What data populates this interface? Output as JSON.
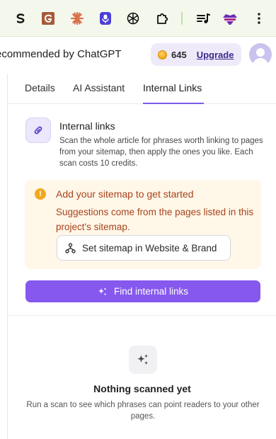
{
  "browser": {
    "extensions": [
      {
        "icon": "s-extension-icon"
      },
      {
        "icon": "g-extension-icon"
      },
      {
        "icon": "claude-icon"
      },
      {
        "icon": "podcast-icon"
      },
      {
        "icon": "chatgpt-icon"
      },
      {
        "icon": "puzzle-icon"
      },
      {
        "icon": "playlist-icon"
      },
      {
        "icon": "incognito-icon"
      },
      {
        "icon": "more-vert-icon"
      }
    ]
  },
  "header": {
    "title": "ecommended by ChatGPT",
    "credits": "645",
    "upgrade_label": "Upgrade"
  },
  "tabs": [
    {
      "label": "Details"
    },
    {
      "label": "AI Assistant"
    },
    {
      "label": "Internal Links",
      "active": true
    }
  ],
  "intro": {
    "title": "Internal links",
    "description": "Scan the whole article for phrases worth linking to pages from your sitemap, then apply the ones you like. Each scan costs 10 credits."
  },
  "warning": {
    "title": "Add your sitemap to get started",
    "description": "Suggestions come from the pages listed in this project's sitemap.",
    "button_label": "Set sitemap in Website & Brand"
  },
  "primary_action": {
    "label": "Find internal links"
  },
  "empty_state": {
    "title": "Nothing scanned yet",
    "description": "Run a scan to see which phrases can point readers to your other pages."
  },
  "colors": {
    "accent": "#8658ee",
    "tab_indicator": "#7b5ce5",
    "warning_bg": "#fff7e8",
    "warning_text": "#a8431d",
    "toolbar_bg": "#f4f8ec"
  }
}
